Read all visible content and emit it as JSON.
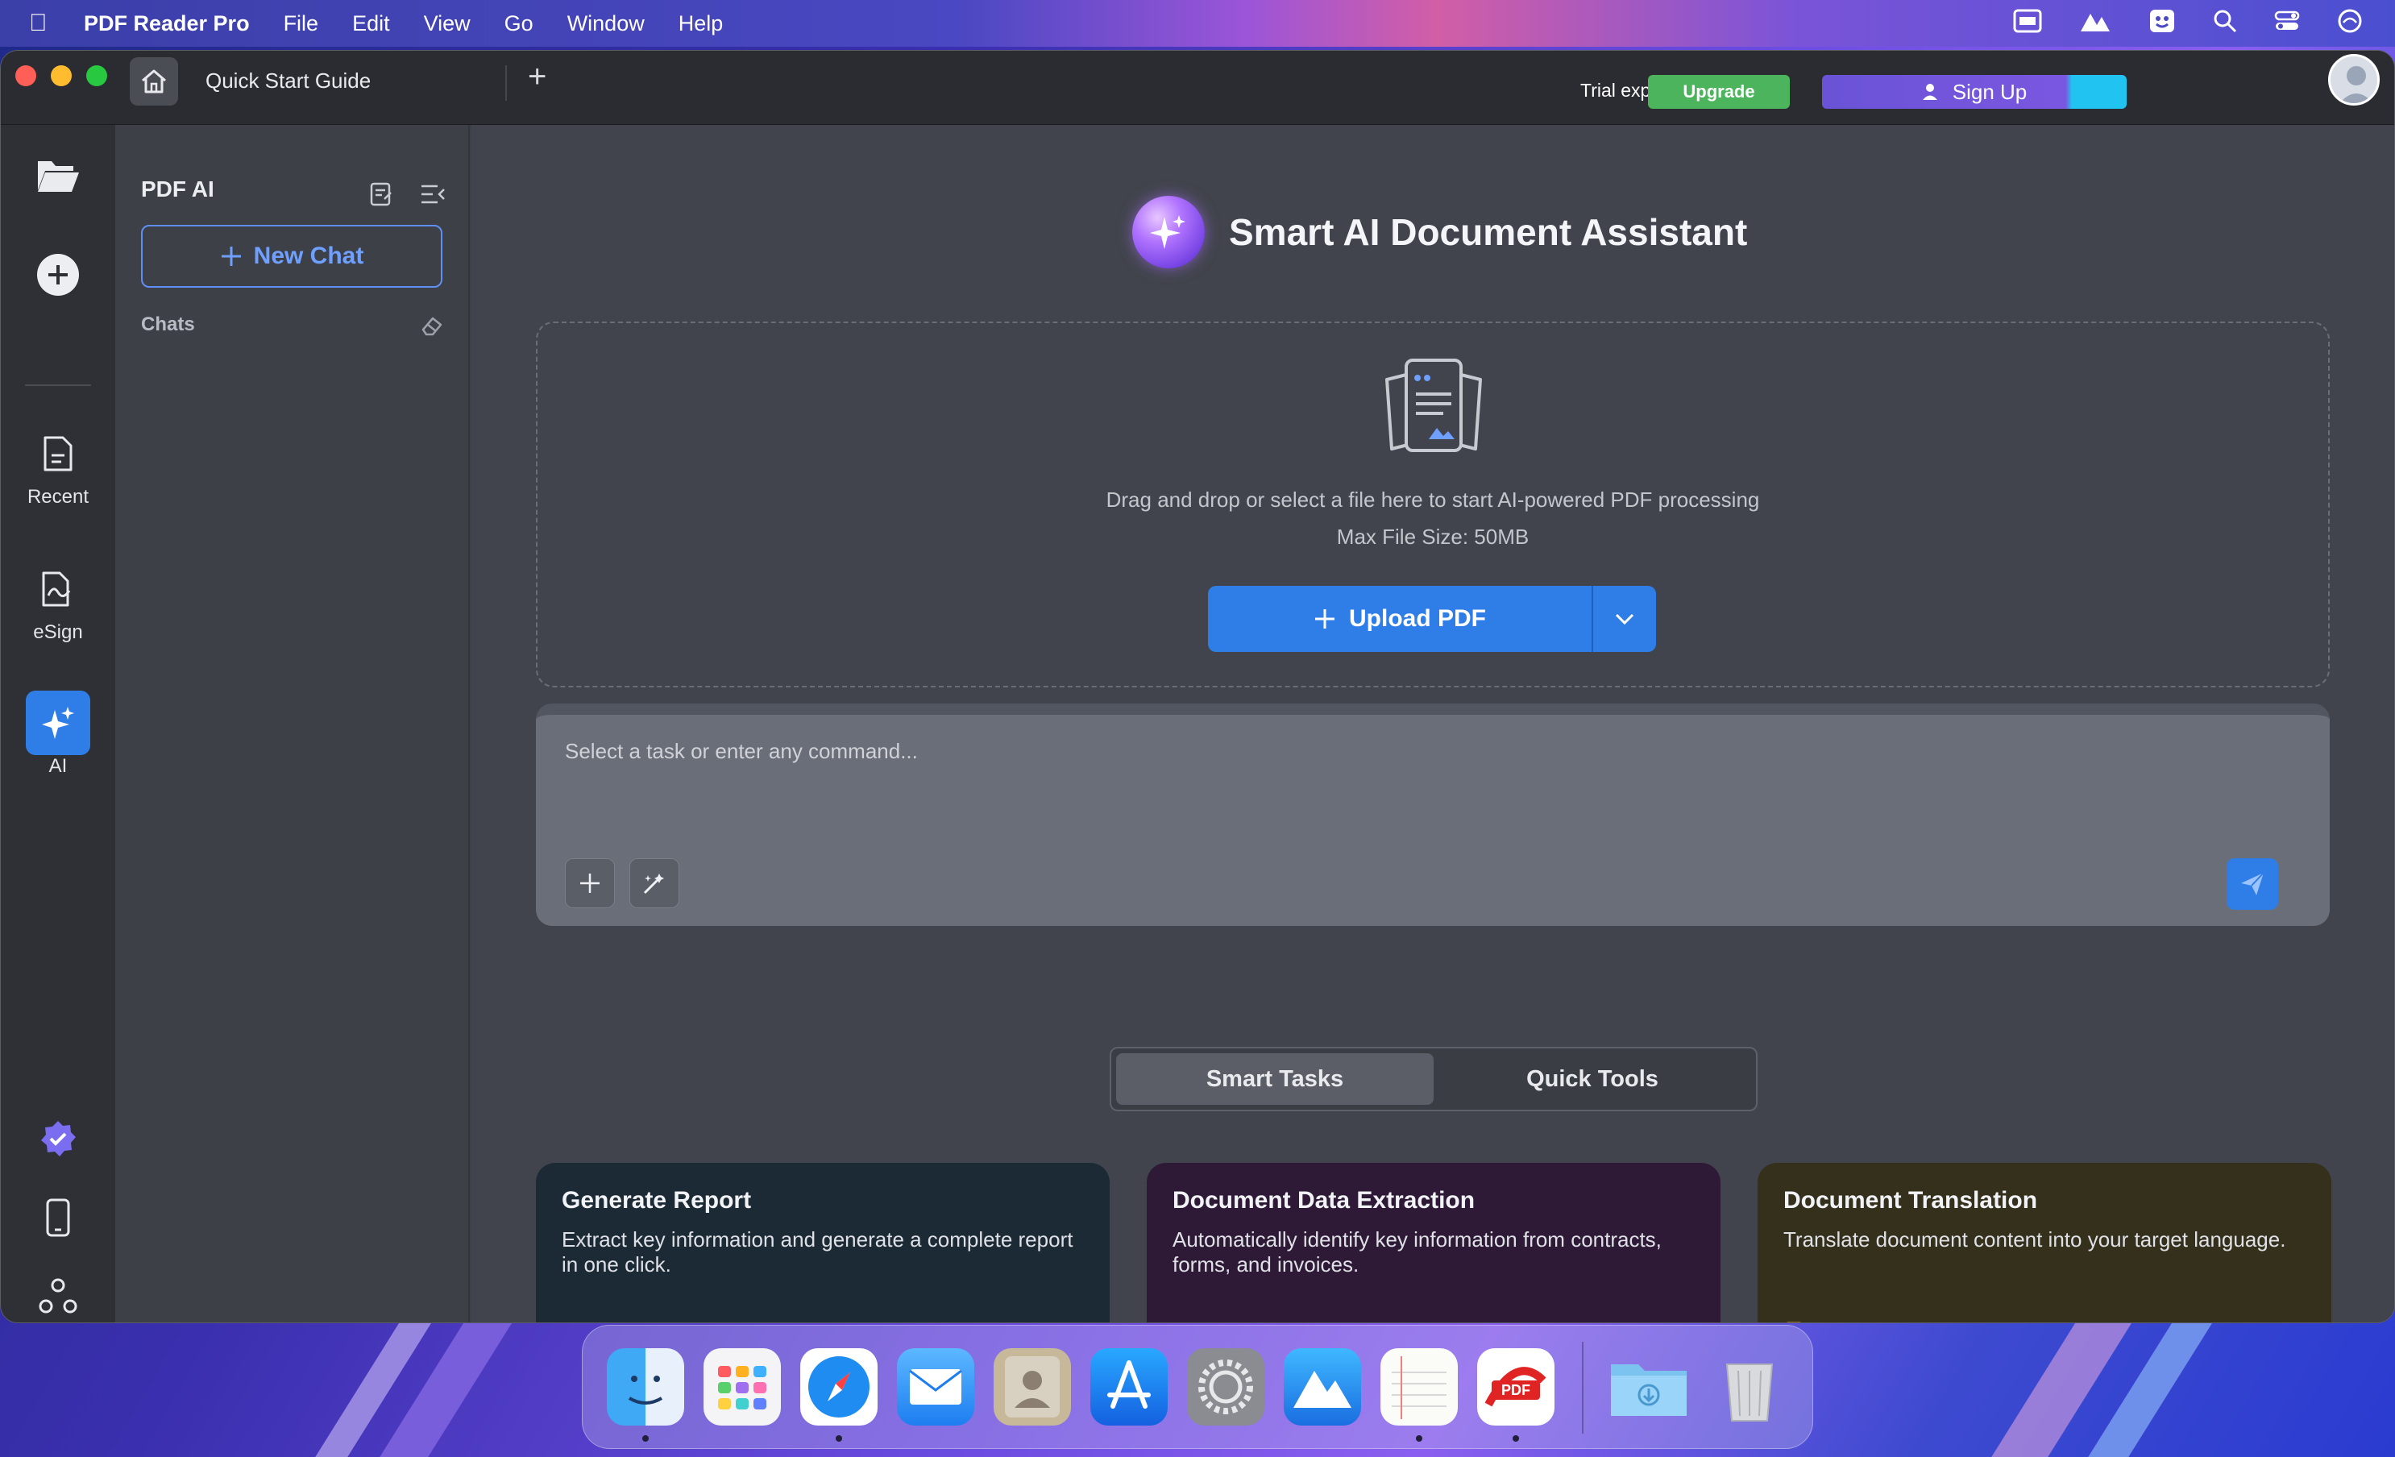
{
  "menubar": {
    "app_name": "PDF Reader Pro",
    "items": [
      "File",
      "Edit",
      "View",
      "Go",
      "Window",
      "Help"
    ]
  },
  "titlebar": {
    "tab_title": "Quick Start Guide",
    "trial_text": "Trial exp",
    "upgrade_label": "Upgrade",
    "signup_label": "Sign Up"
  },
  "rail": {
    "recent_label": "Recent",
    "esign_label": "eSign",
    "ai_label": "AI"
  },
  "sidebar": {
    "title": "PDF AI",
    "new_chat_label": "New Chat",
    "chats_label": "Chats"
  },
  "main": {
    "title": "Smart AI Document Assistant",
    "drop_text": "Drag and drop or select a file here to start AI-powered PDF processing",
    "max_size_text": "Max File Size: 50MB",
    "upload_label": "Upload PDF",
    "command_placeholder": "Select a task or enter any command...",
    "tabs": [
      {
        "label": "Smart Tasks",
        "active": true
      },
      {
        "label": "Quick Tools",
        "active": false
      }
    ],
    "cards": [
      {
        "title": "Generate Report",
        "desc": "Extract key information and generate a complete report in one click.",
        "color": "#1c2a36",
        "icon_color": "#2f8fe0"
      },
      {
        "title": "Document Data Extraction",
        "desc": "Automatically identify key information from contracts, forms, and invoices.",
        "color": "#2e1a36",
        "icon_color": "#b03fd0"
      },
      {
        "title": "Document Translation",
        "desc": "Translate document content into your target language.",
        "color": "#34301c",
        "icon_color": "#e0a030"
      }
    ]
  },
  "colors": {
    "accent": "#2f7ee8",
    "upgrade": "#4cb45c",
    "signup": "#6a53d6"
  }
}
